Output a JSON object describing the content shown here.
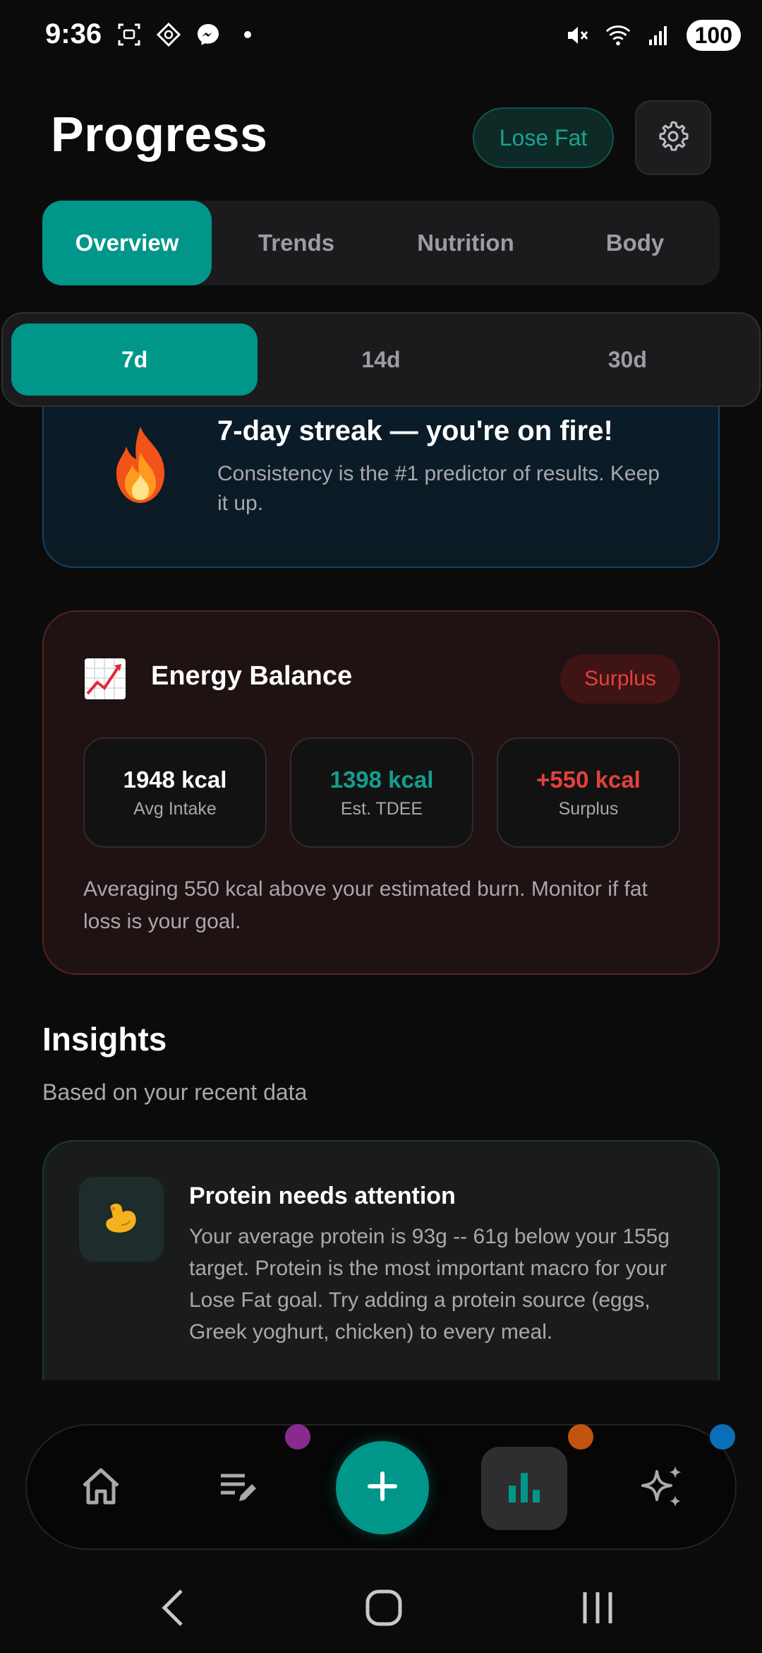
{
  "status_bar": {
    "time": "9:36",
    "battery": "100",
    "left_icons": [
      "screenshot-icon",
      "diamond-app-icon",
      "messenger-icon",
      "dot-icon"
    ],
    "right_icons": [
      "mute-icon",
      "wifi-icon",
      "signal-icon"
    ]
  },
  "header": {
    "title": "Progress",
    "goal_pill": "Lose Fat",
    "settings_icon": "gear-icon"
  },
  "tabs": [
    {
      "label": "Overview",
      "active": true
    },
    {
      "label": "Trends",
      "active": false
    },
    {
      "label": "Nutrition",
      "active": false
    },
    {
      "label": "Body",
      "active": false
    }
  ],
  "period": [
    {
      "label": "7d",
      "active": true
    },
    {
      "label": "14d",
      "active": false
    },
    {
      "label": "30d",
      "active": false
    }
  ],
  "streak": {
    "icon": "fire-icon",
    "title": "7-day streak — you're on fire!",
    "subtitle": "Consistency is the #1 predictor of results. Keep it up."
  },
  "energy": {
    "icon": "chart-increasing-icon",
    "title": "Energy Balance",
    "badge": "Surplus",
    "stats": [
      {
        "value": "1948 kcal",
        "label": "Avg Intake",
        "color": "#ffffff"
      },
      {
        "value": "1398 kcal",
        "label": "Est. TDEE",
        "color": "#139e8f"
      },
      {
        "value": "+550 kcal",
        "label": "Surplus",
        "color": "#e3413f"
      }
    ],
    "note": "Averaging 550 kcal above your estimated burn. Monitor if fat loss is your goal."
  },
  "insights": {
    "title": "Insights",
    "subtitle": "Based on your recent data",
    "cards": [
      {
        "icon": "flexed-biceps-icon",
        "title": "Protein needs attention",
        "body": "Your average protein is 93g -- 61g below your 155g target. Protein is the most important macro for your Lose Fat goal. Try adding a protein source (eggs, Greek yoghurt, chicken) to every meal."
      }
    ]
  },
  "bottom_nav": {
    "items": [
      "home-icon",
      "edit-list-icon",
      "add-icon",
      "bar-chart-icon",
      "sparkles-icon"
    ],
    "active": "bar-chart-icon",
    "dot_colors": [
      "#8a2a8f",
      "#c25410",
      "#0a6fb8"
    ]
  },
  "colors": {
    "accent": "#00968a",
    "danger": "#e3413f",
    "background": "#0b0b0c"
  }
}
